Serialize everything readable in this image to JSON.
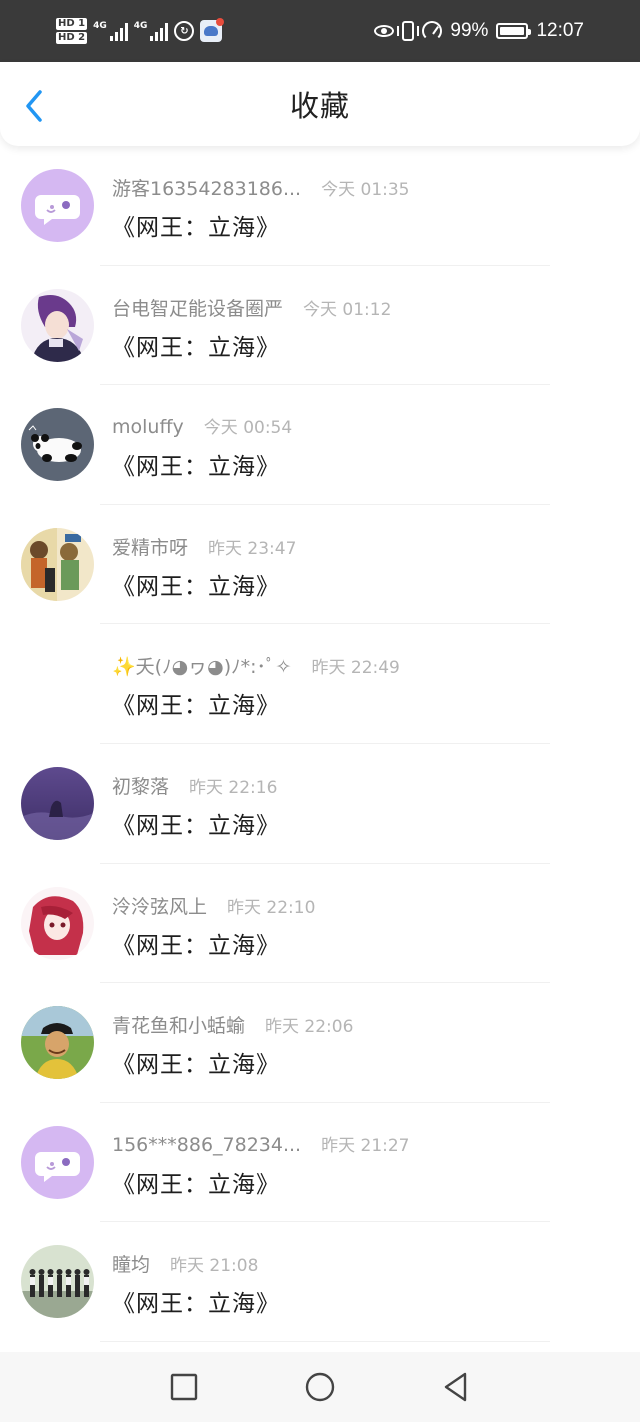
{
  "status_bar": {
    "hd1": "HD 1",
    "hd2": "HD 2",
    "net1": "4G",
    "net2": "4G",
    "battery": "99%",
    "time": "12:07"
  },
  "header": {
    "title": "收藏"
  },
  "items": [
    {
      "name": "游客16354283186...",
      "time": "今天 01:35",
      "message": "《网王：立海》",
      "avatar": "chat-bubble-avatar"
    },
    {
      "name": "台电智疋能设备圈严",
      "time": "今天 01:12",
      "message": "《网王：立海》",
      "avatar": "anime-avatar-purple"
    },
    {
      "name": "moluffy",
      "time": "今天 00:54",
      "message": "《网王：立海》",
      "avatar": "panda-avatar"
    },
    {
      "name": "爱精市呀",
      "time": "昨天 23:47",
      "message": "《网王：立海》",
      "avatar": "manga-cover-avatar"
    },
    {
      "name": "✨夭(ﾉ◕ヮ◕)ﾉ*:･ﾟ✧",
      "time": "昨天 22:49",
      "message": "《网王：立海》",
      "avatar": "blank-avatar"
    },
    {
      "name": "初黎落",
      "time": "昨天 22:16",
      "message": "《网王：立海》",
      "avatar": "purple-night-avatar"
    },
    {
      "name": "泠泠弦风上",
      "time": "昨天 22:10",
      "message": "《网王：立海》",
      "avatar": "red-hair-anime-avatar"
    },
    {
      "name": "青花鱼和小蛞蝓",
      "time": "昨天 22:06",
      "message": "《网王：立海》",
      "avatar": "tennis-player-avatar"
    },
    {
      "name": "156***886_78234...",
      "time": "昨天 21:27",
      "message": "《网王：立海》",
      "avatar": "chat-bubble-avatar"
    },
    {
      "name": "瞳均",
      "time": "昨天 21:08",
      "message": "《网王：立海》",
      "avatar": "group-photo-avatar"
    }
  ],
  "colors": {
    "accent_blue": "#2196f3",
    "avatar_lavender": "#d5b8f2",
    "status_bar": "#3a3a3a"
  }
}
